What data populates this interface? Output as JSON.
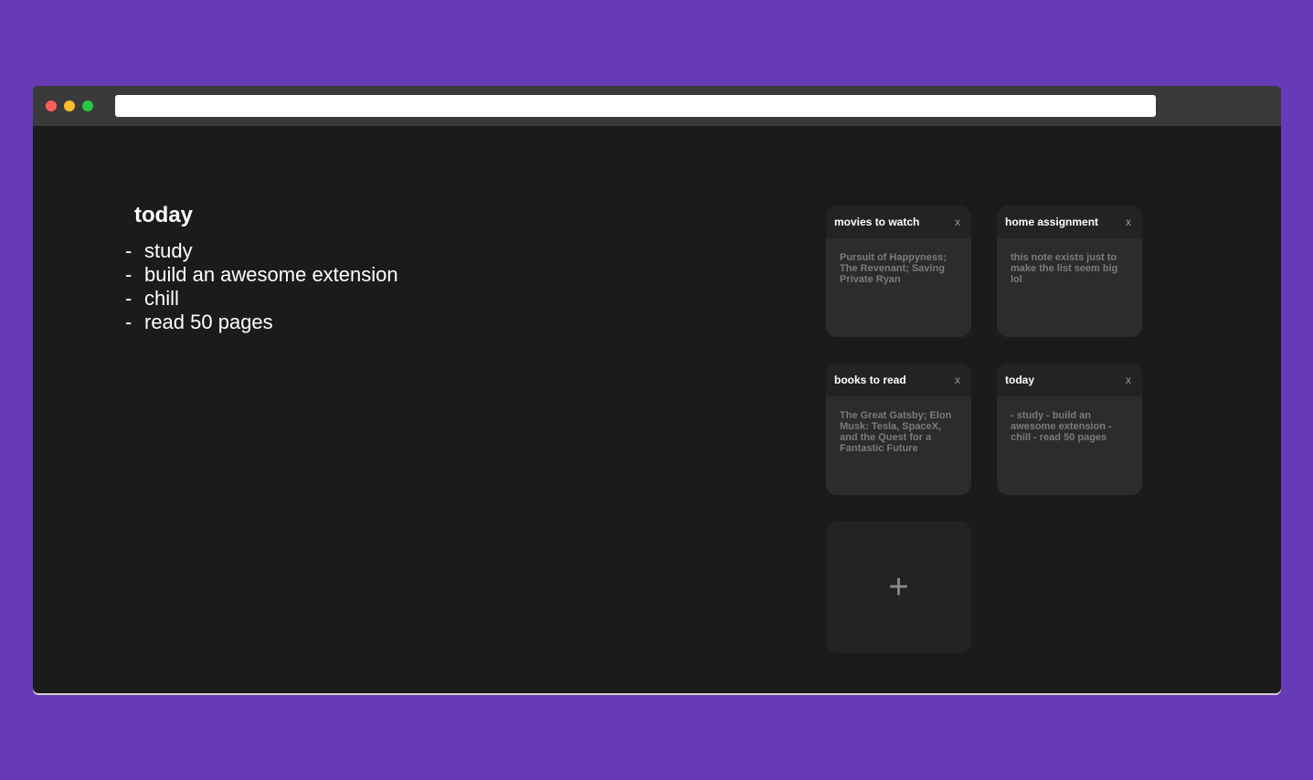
{
  "editor": {
    "title": "today",
    "lines": [
      {
        "dash": "-",
        "text": "study"
      },
      {
        "dash": "-",
        "text": "build an awesome extension"
      },
      {
        "dash": "-",
        "text": "chill"
      },
      {
        "dash": "-",
        "text": "read 50 pages"
      }
    ]
  },
  "notes": [
    {
      "title": "movies to watch",
      "close": "x",
      "body": "Pursuit of Happyness; The Revenant; Saving Private Ryan"
    },
    {
      "title": "home assignment",
      "close": "x",
      "body": "this note exists just to make the list seem big lol"
    },
    {
      "title": "books to read",
      "close": "x",
      "body": "The Great Gatsby; Elon Musk: Tesla, SpaceX, and the Quest for a Fantastic Future"
    },
    {
      "title": "today",
      "close": "x",
      "body": "- study - build an awesome extension - chill - read 50 pages"
    }
  ],
  "add_note": {
    "label": "+"
  },
  "colors": {
    "page_background": "#673ab7",
    "app_background": "#1b1b1b",
    "titlebar": "#3a3a3a",
    "note_background": "#2c2c2c",
    "note_header": "#232323",
    "close_red": "#ff5f57",
    "minimize_yellow": "#febc2e",
    "maximize_green": "#28c840"
  }
}
